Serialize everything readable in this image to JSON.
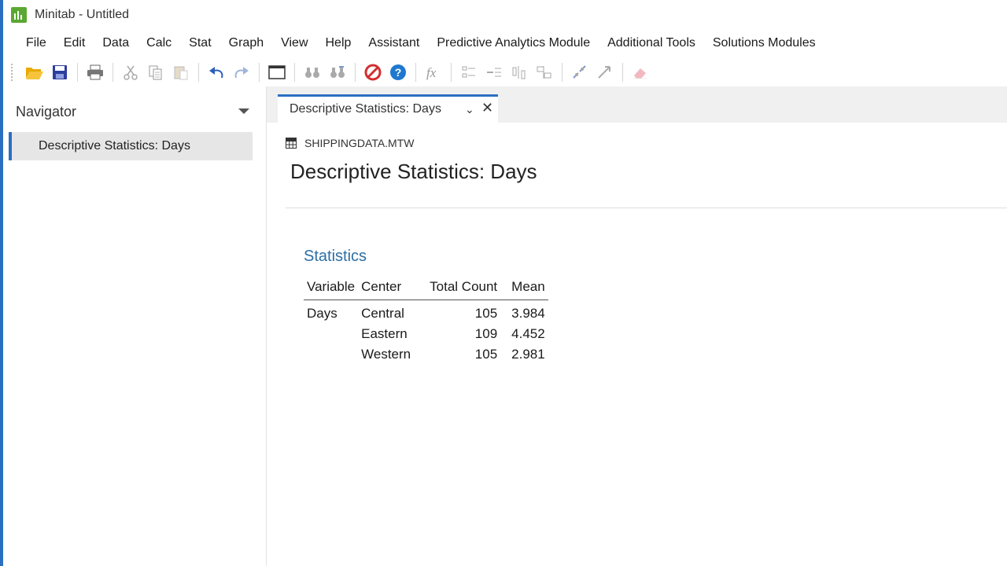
{
  "window": {
    "title": "Minitab - Untitled"
  },
  "menu": [
    "File",
    "Edit",
    "Data",
    "Calc",
    "Stat",
    "Graph",
    "View",
    "Help",
    "Assistant",
    "Predictive Analytics Module",
    "Additional Tools",
    "Solutions Modules"
  ],
  "navigator": {
    "header": "Navigator",
    "items": [
      "Descriptive Statistics: Days"
    ]
  },
  "tab": {
    "label": "Descriptive Statistics: Days",
    "dropdown": "⌄",
    "close": "✕"
  },
  "output": {
    "dataset": "SHIPPINGDATA.MTW",
    "title": "Descriptive Statistics: Days",
    "section": "Statistics",
    "table": {
      "headers": [
        "Variable",
        "Center",
        "Total Count",
        "Mean"
      ],
      "rows": [
        [
          "Days",
          "Central",
          "105",
          "3.984"
        ],
        [
          "",
          "Eastern",
          "109",
          "4.452"
        ],
        [
          "",
          "Western",
          "105",
          "2.981"
        ]
      ]
    }
  },
  "colors": {
    "accent": "#2b6fc2",
    "section_title": "#2b6fa6",
    "stop": "#d32f2f",
    "help": "#1e78d0",
    "save": "#2c3e9e",
    "open": "#f0b400"
  }
}
